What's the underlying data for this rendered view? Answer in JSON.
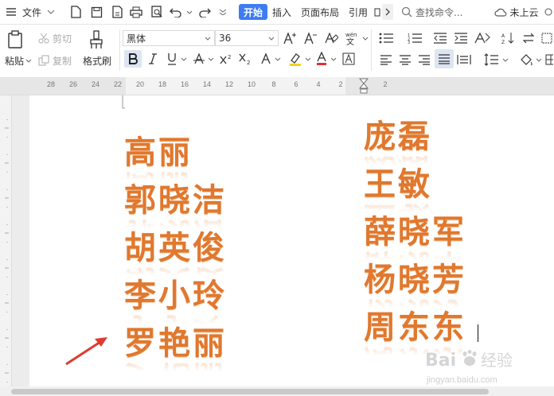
{
  "menubar": {
    "file_label": "文件",
    "tabs": [
      {
        "label": "开始",
        "active": true
      },
      {
        "label": "插入",
        "active": false
      },
      {
        "label": "页面布局",
        "active": false
      },
      {
        "label": "引用",
        "active": false
      }
    ],
    "search_placeholder": "查找命令...",
    "cloud_label": "未上云"
  },
  "toolbar": {
    "paste_label": "粘贴",
    "cut_label": "剪切",
    "copy_label": "复制",
    "format_painter_label": "格式刷",
    "font_name": "黑体",
    "font_size": "36"
  },
  "ruler": {
    "numbers": [
      "28",
      "26",
      "24",
      "22",
      "20",
      "18",
      "16",
      "14",
      "12",
      "10",
      "8",
      "6",
      "4",
      "2",
      "2"
    ]
  },
  "document": {
    "left_column": [
      "高丽",
      "郭晓洁",
      "胡英俊",
      "李小玲",
      "罗艳丽"
    ],
    "right_column": [
      "庞磊",
      "王敏",
      "薛晓军",
      "杨晓芳",
      "周东东"
    ]
  },
  "colors": {
    "accent": "#3d7cf2",
    "name_text": "#e0782e",
    "arrow": "#e03a2f"
  },
  "watermark": {
    "brand": "Bai",
    "brand_suffix": "经验",
    "url": "jingyan.baidu.com"
  }
}
